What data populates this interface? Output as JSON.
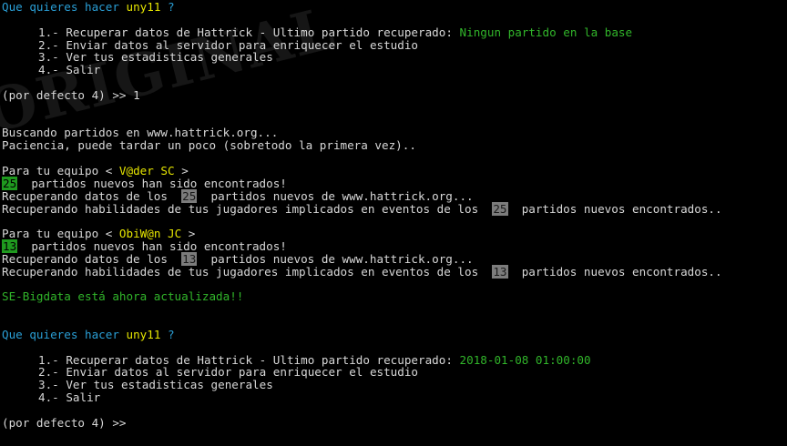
{
  "watermark": "ORIGINAL",
  "prompt1": {
    "question": "Que quieres hacer",
    "user": "uny11",
    "mark": "?"
  },
  "menu1": {
    "opt1": "1.- Recuperar datos de Hattrick - Ultimo partido recuperado:",
    "opt1_value": "Ningun partido en la base",
    "opt2": "2.- Enviar datos al servidor para enriquecer el estudio",
    "opt3": "3.- Ver tus estadisticas generales",
    "opt4": "4.- Salir"
  },
  "input1": {
    "prompt": "(por defecto 4) >>",
    "value": "1"
  },
  "search": {
    "l1": "Buscando partidos en www.hattrick.org...",
    "l2": "Paciencia, puede tardar un poco (sobretodo la primera vez).."
  },
  "team1": {
    "prefix": "Para tu equipo <",
    "name": "V@der SC",
    "suffix": ">",
    "count": "25",
    "found": "partidos nuevos han sido encontrados!",
    "recov_a": "Recuperando datos de los",
    "recov_b": "partidos nuevos de www.hattrick.org...",
    "skill_a": "Recuperando habilidades de tus jugadores implicados en eventos de los",
    "skill_b": "partidos nuevos encontrados.."
  },
  "team2": {
    "prefix": "Para tu equipo <",
    "name": "ObiW@n JC",
    "suffix": ">",
    "count": "13",
    "found": "partidos nuevos han sido encontrados!",
    "recov_a": "Recuperando datos de los",
    "recov_b": "partidos nuevos de www.hattrick.org...",
    "skill_a": "Recuperando habilidades de tus jugadores implicados en eventos de los",
    "skill_b": "partidos nuevos encontrados.."
  },
  "status": "SE-Bigdata está ahora actualizada!!",
  "prompt2": {
    "question": "Que quieres hacer",
    "user": "uny11",
    "mark": "?"
  },
  "menu2": {
    "opt1": "1.- Recuperar datos de Hattrick - Ultimo partido recuperado:",
    "opt1_value": "2018-01-08 01:00:00",
    "opt2": "2.- Enviar datos al servidor para enriquecer el estudio",
    "opt3": "3.- Ver tus estadisticas generales",
    "opt4": "4.- Salir"
  },
  "input2": {
    "prompt": "(por defecto 4) >>"
  },
  "colors": {
    "background": "#000000",
    "text": "#d8d8d8",
    "cyan": "#2a9fd6",
    "yellow": "#e6e600",
    "green": "#31b52a"
  }
}
